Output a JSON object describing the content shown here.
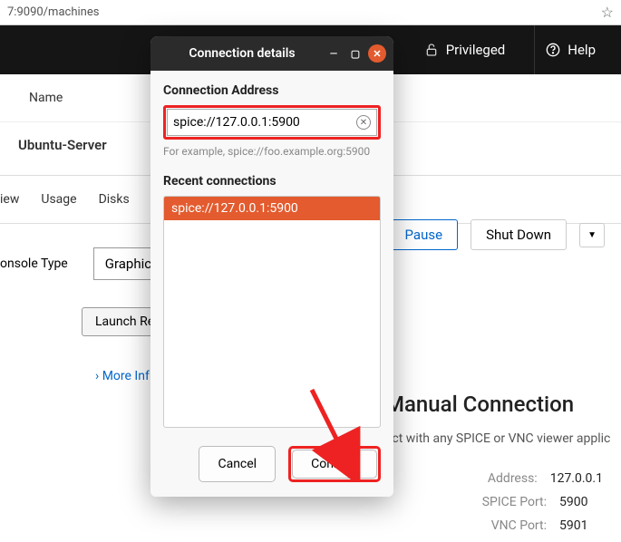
{
  "url_bar": {
    "text": "7:9090/machines"
  },
  "header": {
    "privileged": "Privileged",
    "help": "Help"
  },
  "page": {
    "name_col": "Name",
    "vm_name": "Ubuntu-Server",
    "pause": "Pause",
    "shutdown": "Shut Down",
    "tabs": {
      "overview": "iew",
      "usage": "Usage",
      "disks": "Disks"
    },
    "console_type_label": "onsole Type",
    "console_type_value": "Graphic",
    "launch": "Launch Rem",
    "more_info": "More Inf"
  },
  "manual": {
    "title": "Manual Connection",
    "sub": "ect with any SPICE or VNC viewer applic",
    "address_label": "Address:",
    "address_value": "127.0.0.1",
    "spice_label": "SPICE Port:",
    "spice_value": "5900",
    "vnc_label": "VNC Port:",
    "vnc_value": "5901"
  },
  "dialog": {
    "title": "Connection details",
    "section_address": "Connection Address",
    "address_value": "spice://127.0.0.1:5900",
    "example": "For example, spice://foo.example.org:5900",
    "section_recent": "Recent connections",
    "recent": [
      "spice://127.0.0.1:5900"
    ],
    "cancel": "Cancel",
    "connect": "Connect"
  }
}
